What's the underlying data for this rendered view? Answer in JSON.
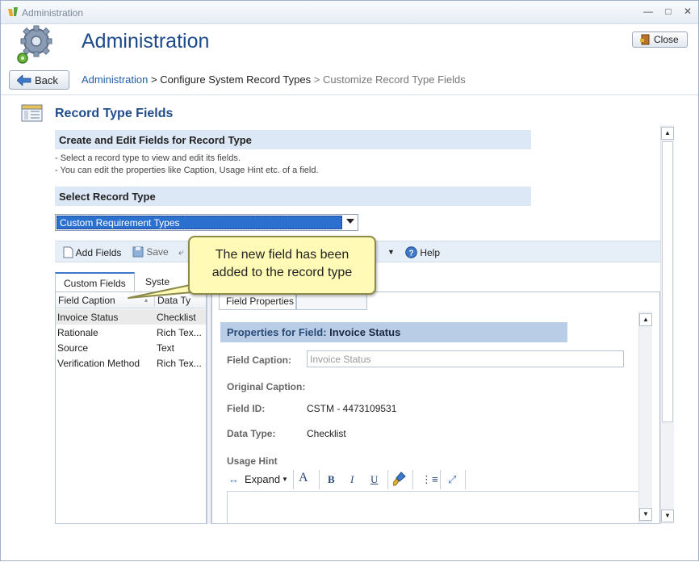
{
  "window": {
    "title": "Administration"
  },
  "header": {
    "title": "Administration",
    "close_label": "Close",
    "back_label": "Back"
  },
  "breadcrumb": {
    "items": [
      "Administration",
      "Configure System Record Types",
      "Customize Record Type Fields"
    ],
    "separator": ">"
  },
  "section": {
    "title": "Record Type Fields",
    "create_heading": "Create and Edit Fields for Record Type",
    "bullets": [
      "-  Select a record type to view and edit its fields.",
      "-  You can edit the properties like Caption, Usage Hint etc. of a field."
    ],
    "select_heading": "Select Record Type",
    "selected_record_type": "Custom Requirement Types"
  },
  "toolbar": {
    "add_fields": "Add Fields",
    "save": "Save",
    "partial_item": "n",
    "help": "Help"
  },
  "left_tabs": {
    "custom": "Custom Fields",
    "system": "Syste"
  },
  "field_list": {
    "headers": [
      "Field Caption",
      "Data Ty"
    ],
    "rows": [
      {
        "caption": "Invoice Status",
        "type": "Checklist"
      },
      {
        "caption": "Rationale",
        "type": "Rich Tex..."
      },
      {
        "caption": "Source",
        "type": "Text"
      },
      {
        "caption": "Verification Method",
        "type": "Rich Tex..."
      }
    ]
  },
  "properties": {
    "tab_label": "Field Properties",
    "band_prefix": "Properties for Field:",
    "band_field": "Invoice Status",
    "field_caption_label": "Field Caption:",
    "field_caption_value": "Invoice Status",
    "original_caption_label": "Original Caption:",
    "field_id_label": "Field ID:",
    "field_id_value": "CSTM - 4473109531",
    "data_type_label": "Data Type:",
    "data_type_value": "Checklist",
    "usage_hint_label": "Usage Hint",
    "expand_label": "Expand"
  },
  "callout": {
    "line1": "The new field has been",
    "line2": "added to the record type"
  },
  "colors": {
    "title_blue": "#1a4a8a",
    "link_blue": "#1f5ea8",
    "band_blue": "#dde8f6",
    "selection_blue": "#2b6fcf",
    "callout_yellow": "#fffbb6"
  }
}
